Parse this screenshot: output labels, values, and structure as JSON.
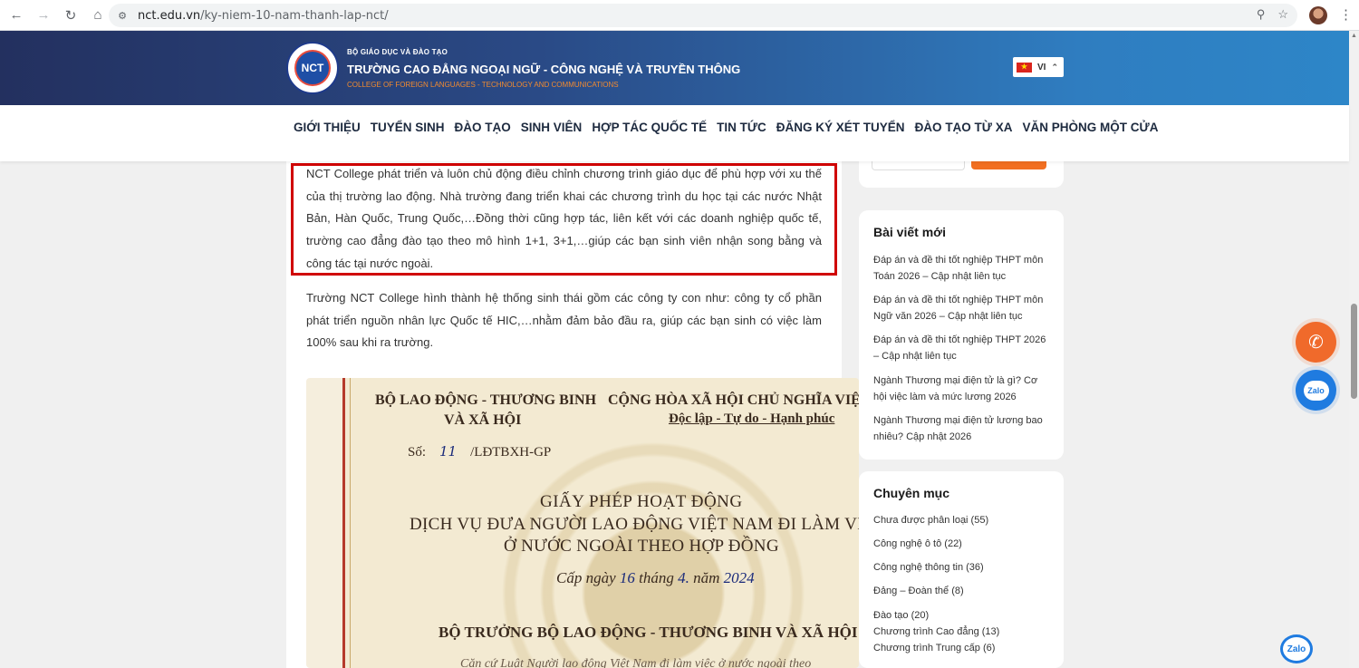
{
  "browser": {
    "url_host": "nct.edu.vn",
    "url_path": "/ky-niem-10-nam-thanh-lap-nct/"
  },
  "header": {
    "logo_text": "NCT",
    "ministry": "BỘ GIÁO DỤC VÀ ĐÀO TẠO",
    "college_name": "TRƯỜNG CAO ĐẲNG NGOẠI NGỮ - CÔNG NGHỆ VÀ TRUYỀN THÔNG",
    "college_name_en": "COLLEGE OF FOREIGN LANGUAGES - TECHNOLOGY AND COMMUNICATIONS",
    "language": "VI"
  },
  "nav": {
    "items": [
      "GIỚI THIỆU",
      "TUYỂN SINH",
      "ĐÀO TẠO",
      "SINH VIÊN",
      "HỢP TÁC QUỐC TẾ",
      "TIN TỨC",
      "ĐĂNG KÝ XÉT TUYỂN",
      "ĐÀO TẠO TỪ XA",
      "VĂN PHÒNG MỘT CỬA"
    ]
  },
  "article": {
    "para1": "NCT College phát triển và luôn chủ động điều chỉnh chương trình giáo dục để phù hợp với xu thế của thị trường lao động. Nhà trường đang triển khai các chương trình du học tại các nước Nhật Bản, Hàn Quốc, Trung Quốc,…Đồng thời cũng hợp tác, liên kết với các doanh nghiệp quốc tế, trường cao đẳng đào tạo theo mô hình 1+1, 3+1,…giúp các bạn sinh viên nhận song bằng và công tác tại nước ngoài.",
    "para2": "Trường NCT College hình thành hệ thống sinh thái gồm các công ty con như: công ty cổ phần phát triển nguồn nhân lực Quốc tế HIC,…nhằm đảm bảo đầu ra, giúp các bạn sinh có việc làm 100% sau khi ra trường."
  },
  "certificate": {
    "ministry_line1": "BỘ LAO ĐỘNG - THƯƠNG BINH",
    "ministry_line2": "VÀ XÃ HỘI",
    "republic": "CỘNG HÒA XÃ HỘI CHỦ NGHĨA VIỆT",
    "motto": "Độc lập - Tự do - Hạnh phúc",
    "number_label": "Số:",
    "number_value": "11",
    "number_suffix": "/LĐTBXH-GP",
    "title1": "GIẤY PHÉP HOẠT ĐỘNG",
    "title2": "DỊCH VỤ ĐƯA NGƯỜI LAO ĐỘNG VIỆT NAM ĐI LÀM VIỆC",
    "title3": "Ở NƯỚC NGOÀI THEO HỢP ĐỒNG",
    "date_prefix": "Cấp ngày",
    "date_day": "16",
    "date_month_label": "tháng",
    "date_month": "4.",
    "date_year_label": "năm",
    "date_year": "2024",
    "minister": "BỘ TRƯỞNG BỘ LAO ĐỘNG - THƯƠNG BINH VÀ XÃ HỘI",
    "bottom_text": "Căn cứ Luật Người lao động Việt Nam đi làm việc ở nước ngoài theo"
  },
  "sidebar": {
    "recent_title": "Bài viết mới",
    "recent_posts": [
      "Đáp án và đề thi tốt nghiệp THPT môn Toán 2026 – Cập nhật liên tục",
      "Đáp án và đề thi tốt nghiệp THPT môn Ngữ văn 2026 – Cập nhật liên tục",
      "Đáp án và đề thi tốt nghiệp THPT 2026 – Cập nhật liên tục",
      "Ngành Thương mại điện tử là gì? Cơ hội việc làm và mức lương 2026",
      "Ngành Thương mại điện tử lương bao nhiêu? Cập nhật 2026"
    ],
    "categories_title": "Chuyên mục",
    "categories": [
      "Chưa được phân loại (55)",
      "Công nghệ ô tô (22)",
      "Công nghệ thông tin (36)",
      "Đảng – Đoàn thể (8)",
      "Đào tạo (20)",
      "Chương trình Cao đẳng (13)",
      "Chương trình Trung cấp (6)"
    ]
  },
  "floating": {
    "zalo_label": "Zalo",
    "zalo_corner_label": "Zalo"
  }
}
